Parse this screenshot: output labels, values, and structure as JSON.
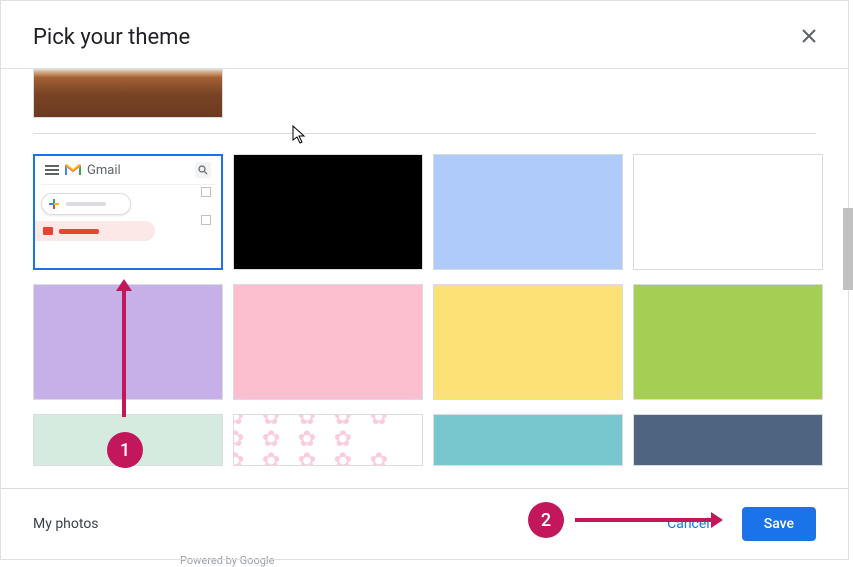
{
  "dialog": {
    "title": "Pick your theme"
  },
  "gmail_tile": {
    "label": "Gmail"
  },
  "footer": {
    "my_photos": "My photos",
    "cancel": "Cancel",
    "save": "Save",
    "powered": "Powered by Google"
  },
  "annotations": {
    "step1": "1",
    "step2": "2"
  }
}
